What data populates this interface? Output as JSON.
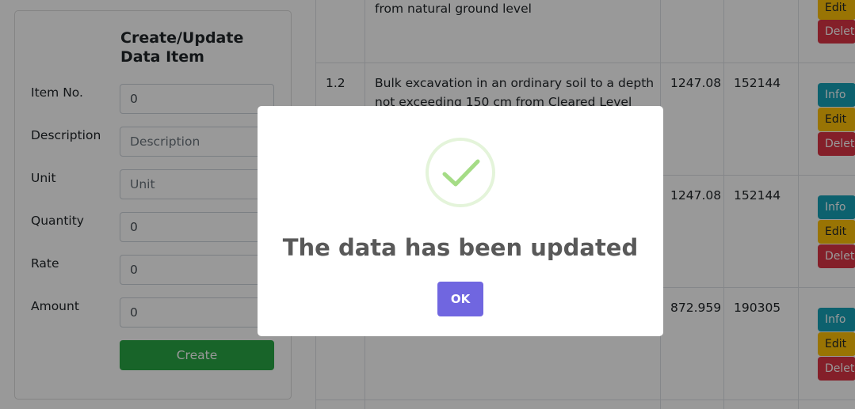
{
  "form": {
    "title": "Create/Update Data Item",
    "fields": {
      "item_no": {
        "label": "Item No.",
        "value": "0"
      },
      "description": {
        "label": "Description",
        "placeholder": "Description"
      },
      "unit": {
        "label": "Unit",
        "placeholder": "Unit"
      },
      "quantity": {
        "label": "Quantity",
        "value": "0"
      },
      "rate": {
        "label": "Rate",
        "value": "0"
      },
      "amount": {
        "label": "Amount",
        "value": "0"
      }
    },
    "create_label": "Create"
  },
  "table": {
    "rows": [
      {
        "item_no": "",
        "description": "from natural ground level",
        "quantity": "",
        "rate": ""
      },
      {
        "item_no": "1.2",
        "description": "Bulk excavation in an ordinary soil to a depth not exceeding 150 cm from Cleared Level",
        "quantity": "1247.08",
        "rate": "152144"
      },
      {
        "item_no": "",
        "description": "",
        "quantity": "1247.08",
        "rate": "152144"
      },
      {
        "item_no": "",
        "description": "",
        "quantity": "872.959",
        "rate": "190305"
      }
    ],
    "actions": {
      "info": "Info",
      "edit": "Edit",
      "delete": "Delete"
    }
  },
  "modal": {
    "title": "The data has been updated",
    "ok_label": "OK",
    "icon": "success-check-icon"
  },
  "colors": {
    "create": "#28a745",
    "info": "#17a2b8",
    "edit": "#ffc107",
    "delete": "#dc3545",
    "ok": "#7066e0",
    "success": "#a5dc86"
  }
}
